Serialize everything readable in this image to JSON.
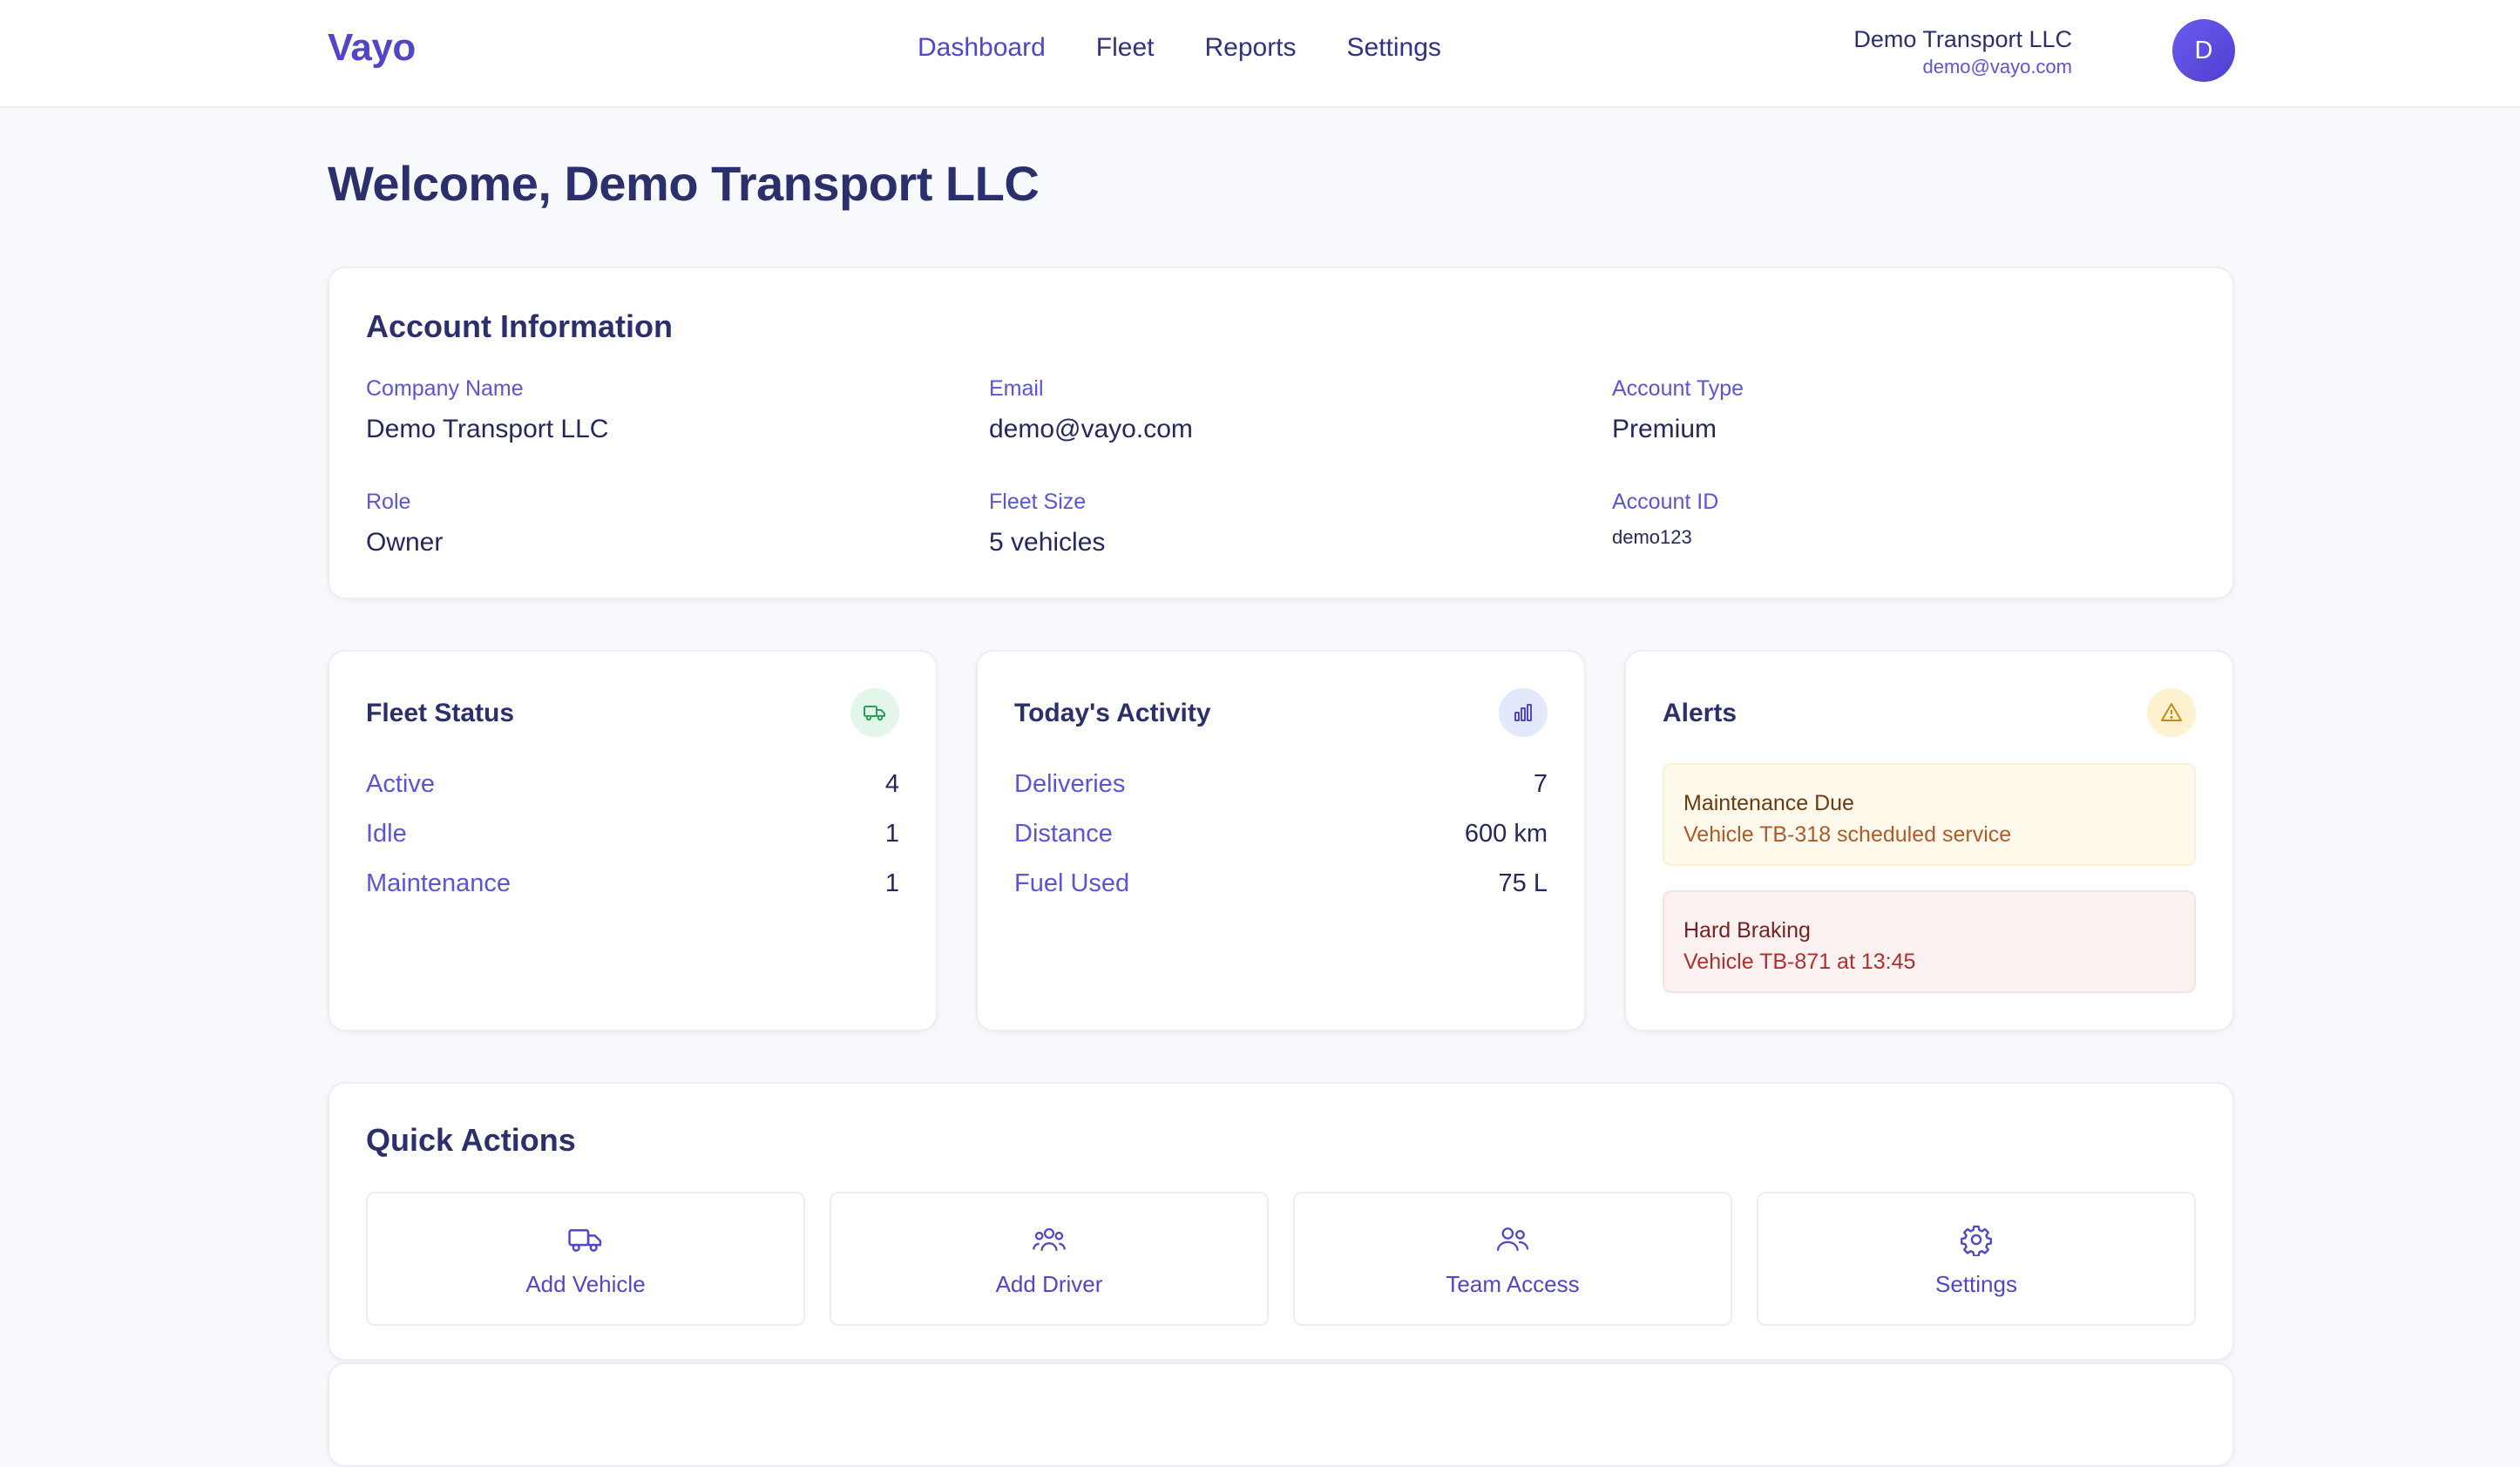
{
  "app": {
    "logo": "Vayo"
  },
  "nav": {
    "items": [
      {
        "label": "Dashboard",
        "active": true
      },
      {
        "label": "Fleet",
        "active": false
      },
      {
        "label": "Reports",
        "active": false
      },
      {
        "label": "Settings",
        "active": false
      }
    ]
  },
  "user": {
    "name": "Demo Transport LLC",
    "email": "demo@vayo.com",
    "avatar_initial": "D"
  },
  "welcome": "Welcome, Demo Transport LLC",
  "account": {
    "title": "Account Information",
    "fields": [
      {
        "label": "Company Name",
        "value": "Demo Transport LLC"
      },
      {
        "label": "Email",
        "value": "demo@vayo.com"
      },
      {
        "label": "Account Type",
        "value": "Premium"
      },
      {
        "label": "Role",
        "value": "Owner"
      },
      {
        "label": "Fleet Size",
        "value": "5 vehicles"
      },
      {
        "label": "Account ID",
        "value": "demo123"
      }
    ]
  },
  "fleet_status": {
    "title": "Fleet Status",
    "icon": "truck-icon",
    "rows": [
      {
        "label": "Active",
        "value": "4"
      },
      {
        "label": "Idle",
        "value": "1"
      },
      {
        "label": "Maintenance",
        "value": "1"
      }
    ]
  },
  "activity": {
    "title": "Today's Activity",
    "icon": "bar-chart-icon",
    "rows": [
      {
        "label": "Deliveries",
        "value": "7"
      },
      {
        "label": "Distance",
        "value": "600 km"
      },
      {
        "label": "Fuel Used",
        "value": "75 L"
      }
    ]
  },
  "alerts": {
    "title": "Alerts",
    "icon": "warning-triangle-icon",
    "items": [
      {
        "title": "Maintenance Due",
        "text": "Vehicle TB-318 scheduled service",
        "severity": "warning"
      },
      {
        "title": "Hard Braking",
        "text": "Vehicle TB-871 at 13:45",
        "severity": "danger"
      }
    ]
  },
  "quick_actions": {
    "title": "Quick Actions",
    "items": [
      {
        "label": "Add Vehicle",
        "icon": "truck-icon"
      },
      {
        "label": "Add Driver",
        "icon": "users-group-icon"
      },
      {
        "label": "Team Access",
        "icon": "users-icon"
      },
      {
        "label": "Settings",
        "icon": "gear-icon"
      }
    ]
  },
  "colors": {
    "accent": "#4f46c8",
    "text_dark": "#2b2f6b",
    "fleet_icon_bg": "#e3f6ea",
    "activity_icon_bg": "#e4e8fb",
    "alerts_icon_bg": "#fdf1cf"
  }
}
